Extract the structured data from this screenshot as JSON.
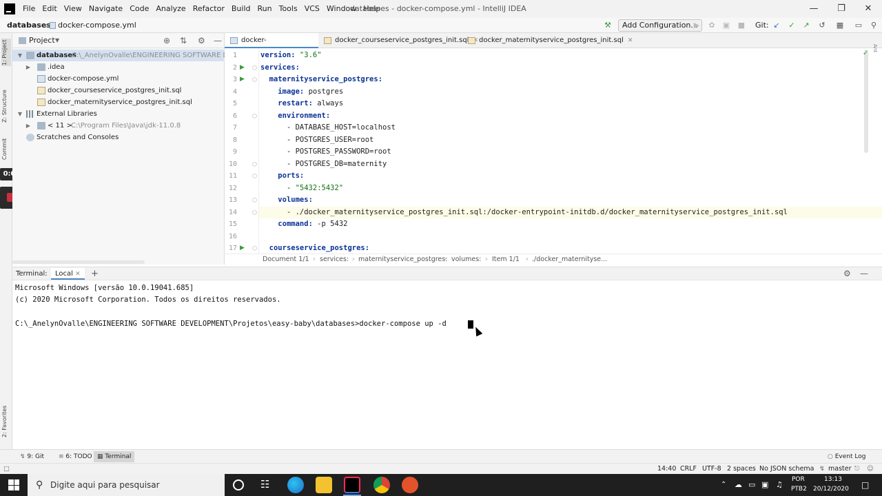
{
  "menubar": {
    "items": [
      "File",
      "Edit",
      "View",
      "Navigate",
      "Code",
      "Analyze",
      "Refactor",
      "Build",
      "Run",
      "Tools",
      "VCS",
      "Window",
      "Help"
    ],
    "title": "databases - docker-compose.yml - IntelliJ IDEA"
  },
  "navbar": {
    "crumb_root": "databases",
    "crumb_file": "docker-compose.yml",
    "add_config": "Add Configuration...",
    "git_label": "Git:"
  },
  "left_stripe": {
    "project": "1: Project",
    "structure": "Z: Structure",
    "commit": "Commit",
    "favorites": "2: Favorites",
    "rec_time": "0:00"
  },
  "project_panel": {
    "title": "Project",
    "tree": [
      {
        "label": "databases",
        "path": "C:\\_AnelynOvalle\\ENGINEERING SOFTWARE DEVEL"
      },
      {
        "label": ".idea"
      },
      {
        "label": "docker-compose.yml"
      },
      {
        "label": "docker_courseservice_postgres_init.sql"
      },
      {
        "label": "docker_maternityservice_postgres_init.sql"
      },
      {
        "label": "External Libraries"
      },
      {
        "label": "< 11 >",
        "path": "C:\\Program Files\\Java\\jdk-11.0.8"
      },
      {
        "label": "Scratches and Consoles"
      }
    ]
  },
  "editor": {
    "tabs": [
      "docker-compose.yml",
      "docker_courseservice_postgres_init.sql",
      "docker_maternityservice_postgres_init.sql"
    ],
    "lines": [
      {
        "n": "1",
        "key": "version",
        "val": "\"3.6\"",
        "indent": 0
      },
      {
        "n": "2",
        "key": "services",
        "val": "",
        "indent": 0
      },
      {
        "n": "3",
        "key": "maternityservice_postgres",
        "val": "",
        "indent": 2
      },
      {
        "n": "4",
        "key": "image",
        "val": "postgres",
        "indent": 4
      },
      {
        "n": "5",
        "key": "restart",
        "val": "always",
        "indent": 4
      },
      {
        "n": "6",
        "key": "environment",
        "val": "",
        "indent": 4
      },
      {
        "n": "7",
        "item": "- DATABASE_HOST=localhost",
        "indent": 6
      },
      {
        "n": "8",
        "item": "- POSTGRES_USER=root",
        "indent": 6
      },
      {
        "n": "9",
        "item": "- POSTGRES_PASSWORD=root",
        "indent": 6
      },
      {
        "n": "10",
        "item": "- POSTGRES_DB=maternity",
        "indent": 6
      },
      {
        "n": "11",
        "key": "ports",
        "val": "",
        "indent": 4
      },
      {
        "n": "12",
        "item": "- ",
        "str": "\"5432:5432\"",
        "indent": 6
      },
      {
        "n": "13",
        "key": "volumes",
        "val": "",
        "indent": 4
      },
      {
        "n": "14",
        "item": "- ./docker_maternityservice_postgres_init.sql:/docker-entrypoint-initdb.d/docker_maternityservice_postgres_init.sql",
        "indent": 6
      },
      {
        "n": "15",
        "key": "command",
        "val": "-p 5432",
        "indent": 4
      },
      {
        "n": "16",
        "key": "",
        "val": "",
        "indent": 0
      },
      {
        "n": "17",
        "key": "courseservice_postgres",
        "val": "",
        "indent": 2
      }
    ],
    "breadcrumbs": [
      "Document 1/1",
      "services:",
      "maternityservice_postgres:",
      "volumes:",
      "Item 1/1",
      "./docker_maternityse..."
    ]
  },
  "terminal": {
    "title": "Terminal:",
    "tab": "Local",
    "lines": [
      "Microsoft Windows [versão 10.0.19041.685]",
      "(c) 2020 Microsoft Corporation. Todos os direitos reservados.",
      "",
      "C:\\_AnelynOvalle\\ENGINEERING SOFTWARE DEVELOPMENT\\Projetos\\easy-baby\\databases>docker-compose up -d"
    ]
  },
  "bottom_tabs": [
    "9: Git",
    "6: TODO",
    "Terminal"
  ],
  "status": {
    "position": "14:40",
    "line_sep": "CRLF",
    "encoding": "UTF-8",
    "indent": "2 spaces",
    "schema": "No JSON schema",
    "branch": "master",
    "event_log": "Event Log"
  },
  "taskbar": {
    "search": "Digite aqui para pesquisar",
    "lang": "POR",
    "layout": "PTB2",
    "time": "13:13",
    "date": "20/12/2020"
  }
}
